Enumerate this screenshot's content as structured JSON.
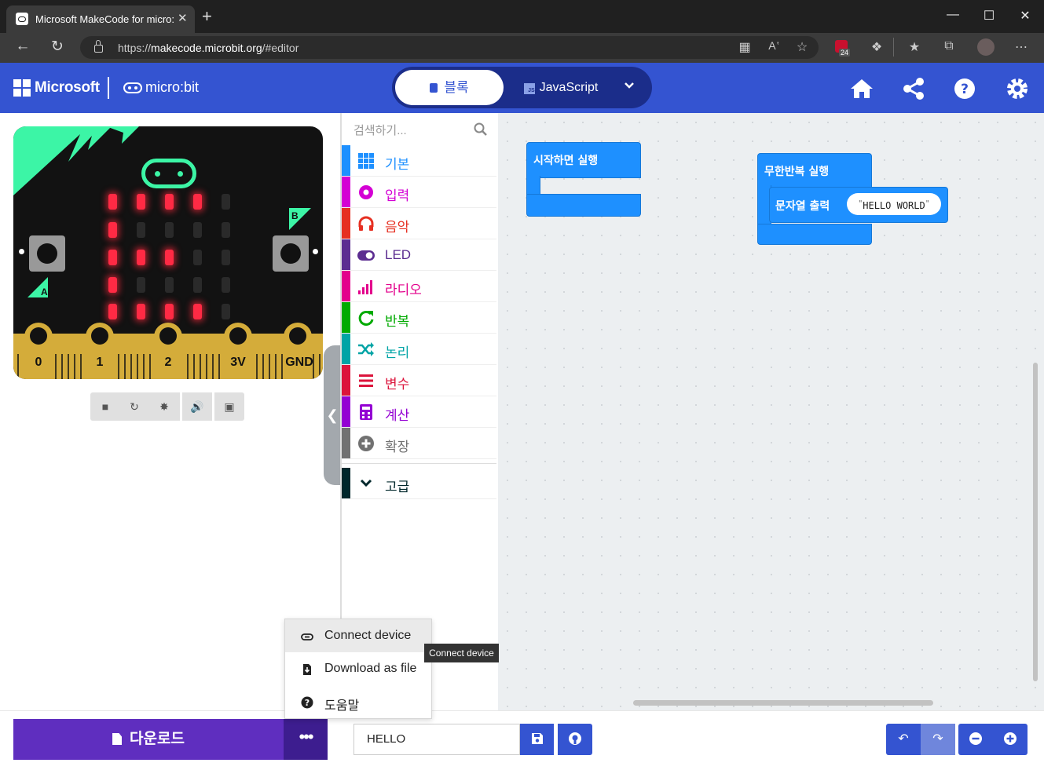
{
  "browser": {
    "tab_title": "Microsoft MakeCode for micro:bit",
    "tab_close": "✕",
    "new_tab": "+",
    "url_prefix": "https://",
    "url_host": "makecode.microbit.org",
    "url_path": "/#editor",
    "badge_count": "24",
    "window_minimize": "—",
    "window_maximize": "☐",
    "window_close": "✕"
  },
  "header": {
    "brand": "Microsoft",
    "product": "micro:bit",
    "tab_blocks": "블록",
    "tab_js": "JavaScript",
    "js_badge": "JS"
  },
  "simulator": {
    "pins": [
      "0",
      "1",
      "2",
      "3V",
      "GND"
    ],
    "button_a": "A",
    "button_b": "B",
    "led_matrix": [
      [
        1,
        1,
        1,
        1,
        0
      ],
      [
        1,
        0,
        0,
        0,
        0
      ],
      [
        1,
        1,
        1,
        0,
        0
      ],
      [
        1,
        0,
        0,
        0,
        0
      ],
      [
        1,
        1,
        1,
        1,
        0
      ]
    ],
    "toolbar": [
      "stop",
      "restart",
      "debug",
      "mute",
      "fullscreen"
    ]
  },
  "toolbox": {
    "search_placeholder": "검색하기...",
    "categories": [
      {
        "label": "기본",
        "color": "#1e90ff",
        "icon": "grid-icon"
      },
      {
        "label": "입력",
        "color": "#d400d4",
        "icon": "input-icon"
      },
      {
        "label": "음악",
        "color": "#e63022",
        "icon": "headphones-icon"
      },
      {
        "label": "LED",
        "color": "#5c2d91",
        "icon": "toggle-icon"
      },
      {
        "label": "라디오",
        "color": "#e3008c",
        "icon": "signal-icon"
      },
      {
        "label": "반복",
        "color": "#00aa00",
        "icon": "refresh-icon"
      },
      {
        "label": "논리",
        "color": "#00a4a6",
        "icon": "shuffle-icon"
      },
      {
        "label": "변수",
        "color": "#dc143c",
        "icon": "list-icon"
      },
      {
        "label": "계산",
        "color": "#9400d3",
        "icon": "calculator-icon"
      },
      {
        "label": "확장",
        "color": "#717171",
        "icon": "plus-circle-icon"
      }
    ],
    "advanced": {
      "label": "고급",
      "color": "#00272b"
    }
  },
  "workspace": {
    "on_start_label": "시작하면 실행",
    "forever_label": "무한반복 실행",
    "show_string_label": "문자열 출력",
    "string_value": "HELLO WORLD"
  },
  "bottom": {
    "download_label": "다운로드",
    "more_label": "•••",
    "project_name": "HELLO"
  },
  "popup_menu": {
    "items": [
      {
        "label": "Connect device"
      },
      {
        "label": "Download as file"
      },
      {
        "label": "도움말"
      }
    ],
    "tooltip": "Connect device"
  }
}
